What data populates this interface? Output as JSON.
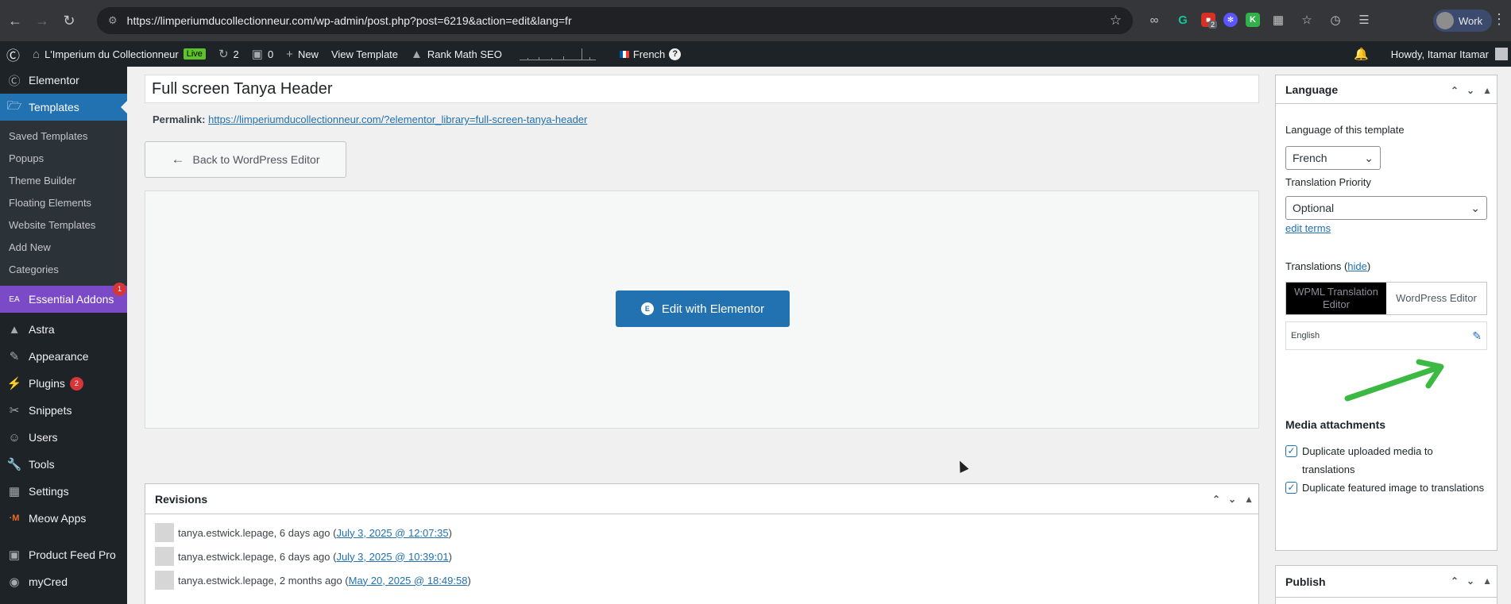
{
  "browser": {
    "url": "https://limperiumducollectionneur.com/wp-admin/post.php?post=6219&action=edit&lang=fr",
    "extension_badge": "2",
    "profile_label": "Work"
  },
  "adminbar": {
    "site_name": "L'Imperium du Collectionneur",
    "live_label": "Live",
    "updates_count": "2",
    "comments_count": "0",
    "new_label": "New",
    "view_template": "View Template",
    "rank_math": "Rank Math SEO",
    "language": "French",
    "help": "?",
    "howdy": "Howdy, Itamar Itamar"
  },
  "sidebar": {
    "elementor": "Elementor",
    "templates": "Templates",
    "submenu": [
      "Saved Templates",
      "Popups",
      "Theme Builder",
      "Floating Elements",
      "Website Templates",
      "Add New",
      "Categories"
    ],
    "essential_addons": "Essential Addons",
    "essential_addons_badge": "1",
    "astra": "Astra",
    "appearance": "Appearance",
    "plugins": "Plugins",
    "plugins_badge": "2",
    "snippets": "Snippets",
    "users": "Users",
    "tools": "Tools",
    "settings": "Settings",
    "meow_apps": "Meow Apps",
    "product_feed": "Product Feed Pro",
    "mycred": "myCred"
  },
  "editor": {
    "title": "Full screen Tanya Header",
    "permalink_label": "Permalink:",
    "permalink_url": "https://limperiumducollectionneur.com/?elementor_library=full-screen-tanya-header",
    "back_button": "Back to WordPress Editor",
    "edit_elementor": "Edit with Elementor"
  },
  "revisions": {
    "title": "Revisions",
    "rows": [
      {
        "author": "tanya.estwick.lepage, 6 days ago (",
        "date": "July 3, 2025 @ 12:07:35",
        "close": ")"
      },
      {
        "author": "tanya.estwick.lepage, 6 days ago (",
        "date": "July 3, 2025 @ 10:39:01",
        "close": ")"
      },
      {
        "author": "tanya.estwick.lepage, 2 months ago (",
        "date": "May 20, 2025 @ 18:49:58",
        "close": ")"
      }
    ]
  },
  "language_box": {
    "title": "Language",
    "lang_of_template": "Language of this template",
    "lang_value": "French",
    "priority_label": "Translation Priority",
    "priority_value": "Optional",
    "edit_terms": "edit terms",
    "translations_label": "Translations (",
    "hide": "hide",
    "translations_close": ")",
    "tab_wpml": "WPML Translation Editor",
    "tab_wp": "WordPress Editor",
    "translation_language": "English",
    "media_title": "Media attachments",
    "dup_media": "Duplicate uploaded media to translations",
    "dup_featured": "Duplicate featured image to translations"
  },
  "publish_box": {
    "title": "Publish"
  },
  "colors": {
    "accent": "#2271b1",
    "admin_dark": "#1d2327",
    "ea_purple": "#7b4ac7",
    "arrow_green": "#3cb943"
  }
}
